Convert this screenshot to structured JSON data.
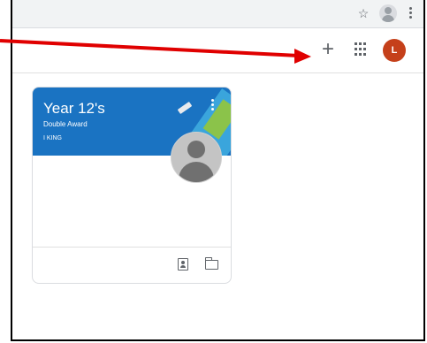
{
  "browser": {
    "star_icon": "star-icon",
    "profile_icon": "profile-icon",
    "menu_icon": "more-vert-icon"
  },
  "header": {
    "add_symbol": "+",
    "apps_icon": "apps-grid-icon",
    "avatar_letter": "L",
    "avatar_color": "#c5401a"
  },
  "class_card": {
    "title": "Year 12's",
    "section": "Double Award",
    "teacher": "I KING",
    "banner_color": "#1a73c2",
    "footer_icons": [
      "assignment-ind-icon",
      "folder-icon"
    ]
  },
  "annotation": {
    "arrow_color": "#e00000",
    "points_to": "add-icon"
  }
}
